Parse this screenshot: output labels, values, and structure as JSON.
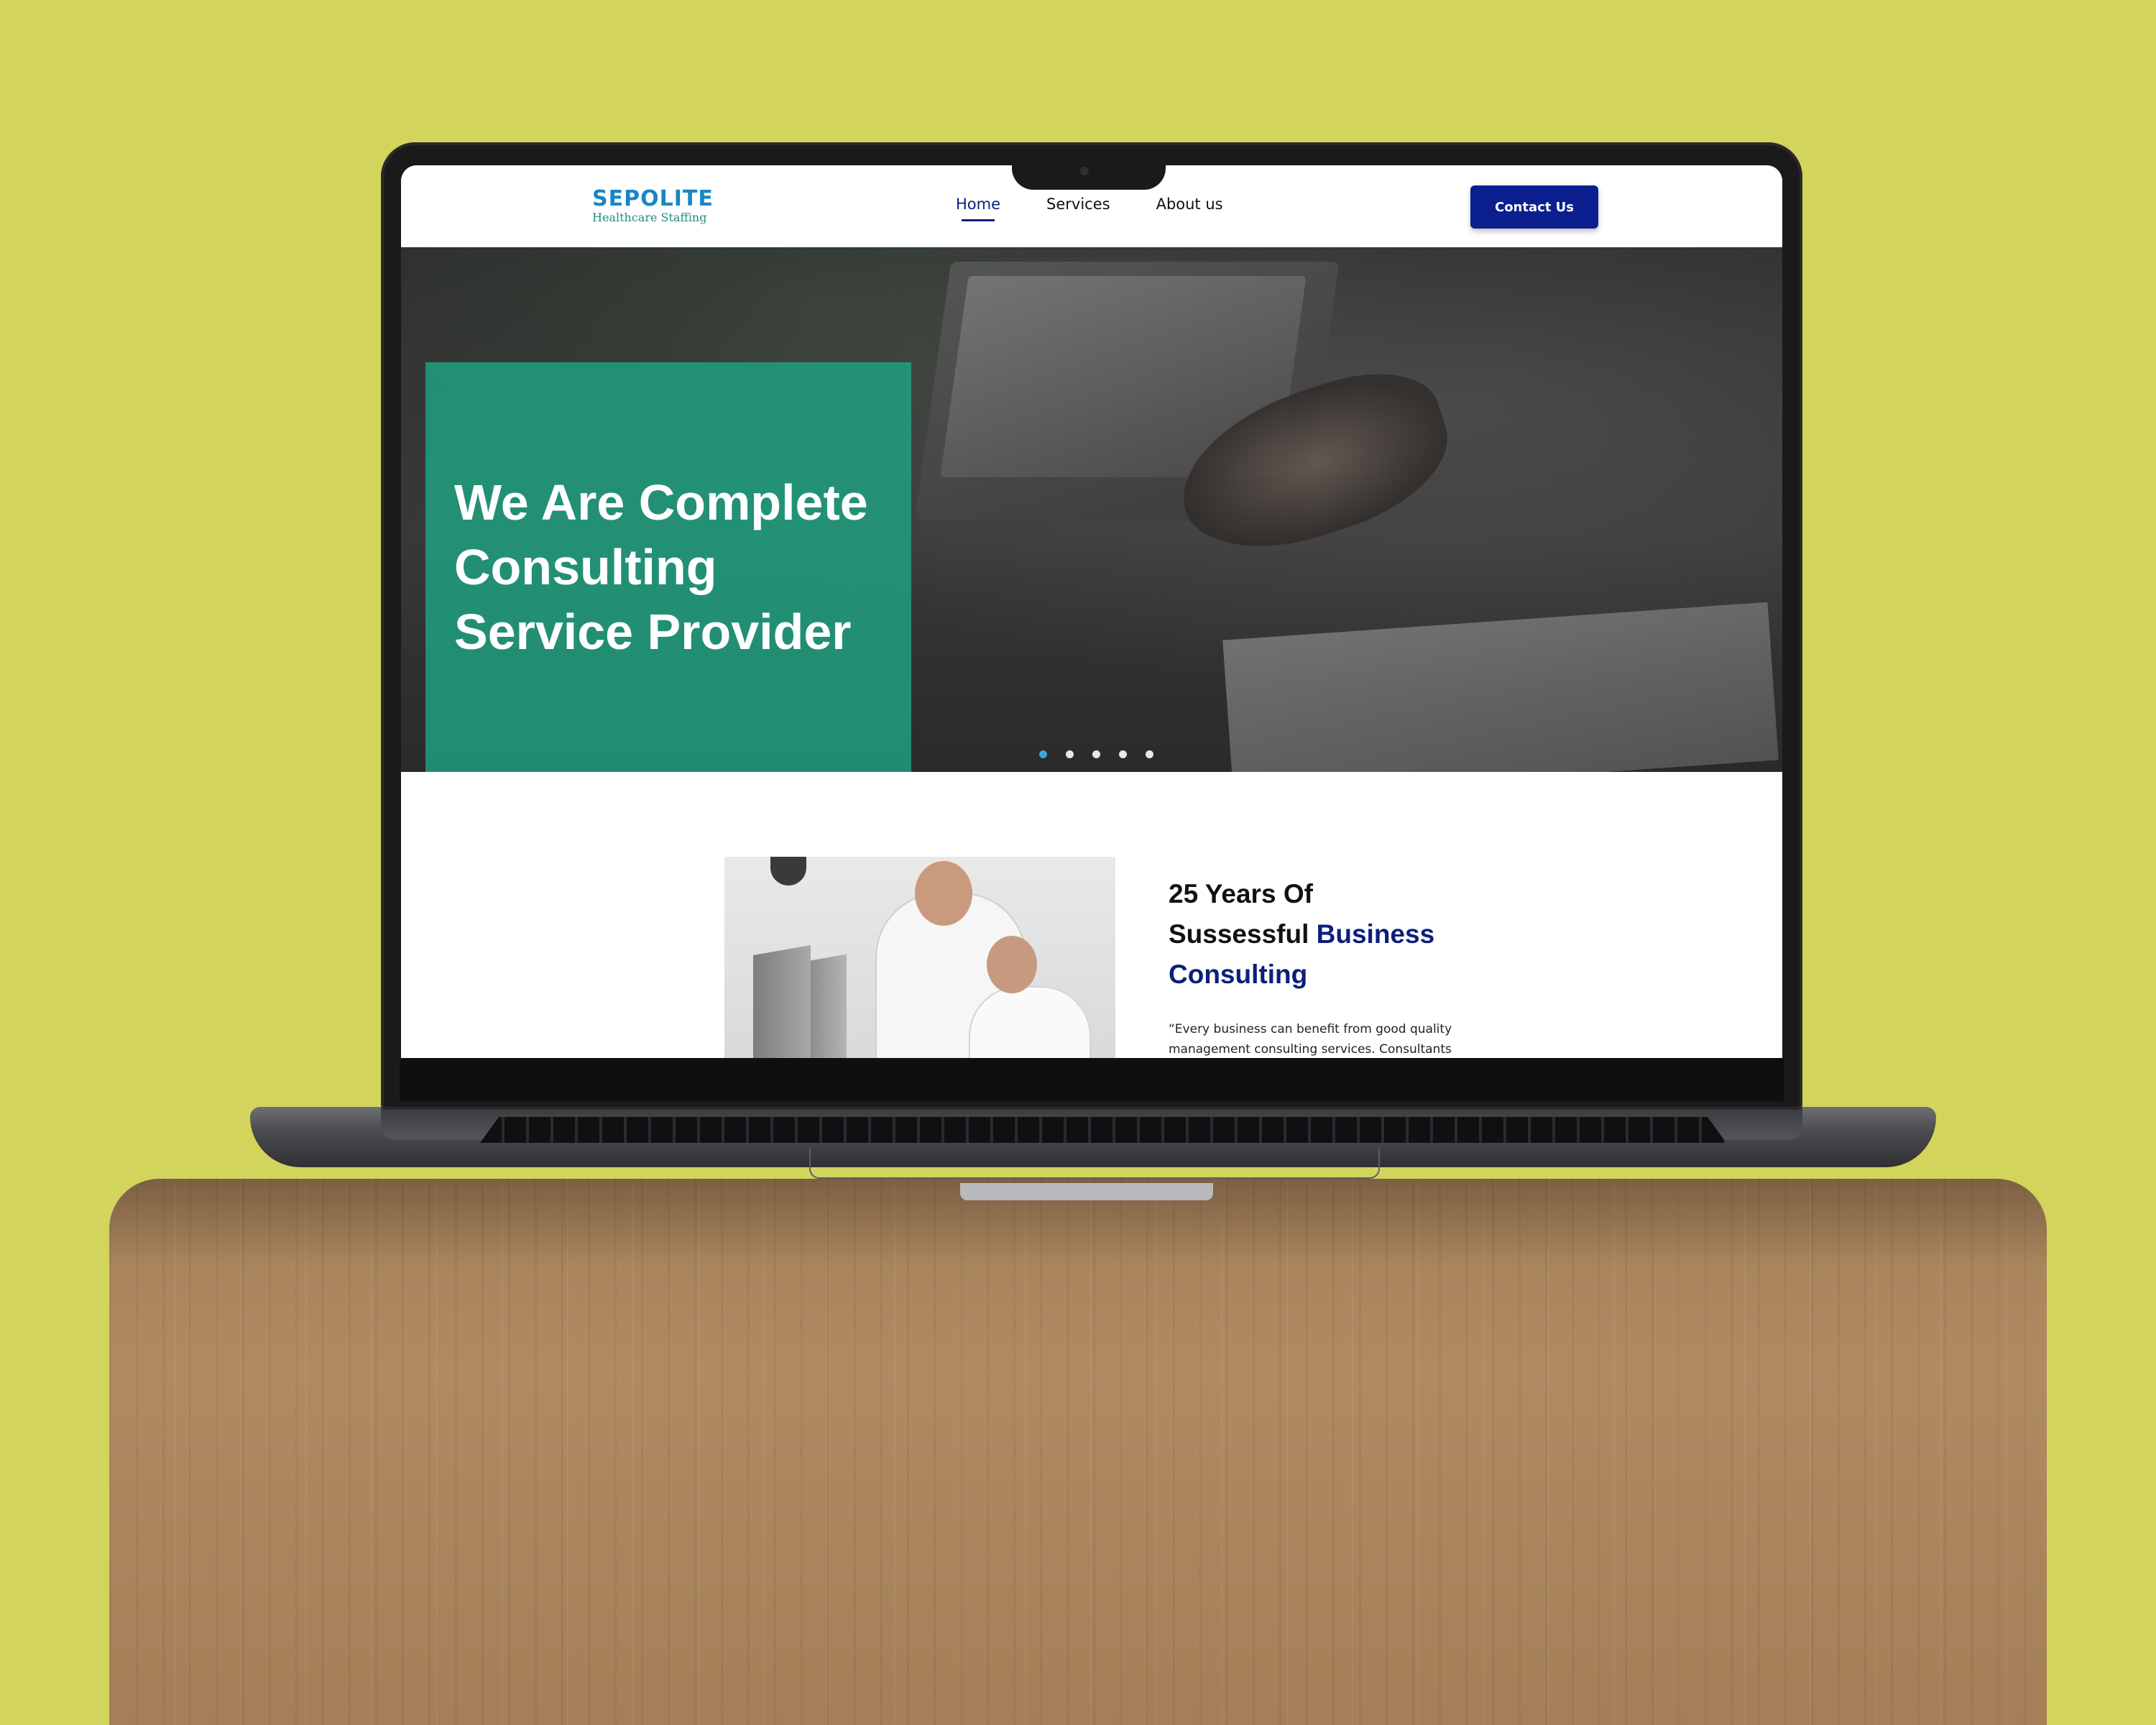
{
  "site": {
    "logo": {
      "word": "SEPOLITE",
      "tagline": "Healthcare Staffing"
    },
    "nav": [
      {
        "label": "Home",
        "active": true
      },
      {
        "label": "Services",
        "active": false
      },
      {
        "label": "About us",
        "active": false
      }
    ],
    "contact_button": "Contact Us"
  },
  "hero": {
    "title_lines": [
      "We Are Complete",
      "Consulting",
      "Service Provider"
    ],
    "slides_total": 5,
    "active_slide": 1
  },
  "about": {
    "heading_line1": "25 Years Of",
    "heading_line2_plain": "Sussessful",
    "heading_line2_accent": "Business",
    "heading_line3_accent": "Consulting",
    "text_line1": "“Every business can benefit from good quality",
    "text_line2": "management consulting services. Consultants"
  },
  "colors": {
    "background": "#d3d45c",
    "brand_blue": "#0b1f8f",
    "logo_blue": "#1a86c3",
    "hero_green": "#1fa383",
    "accent_navy": "#0b1f7a"
  }
}
